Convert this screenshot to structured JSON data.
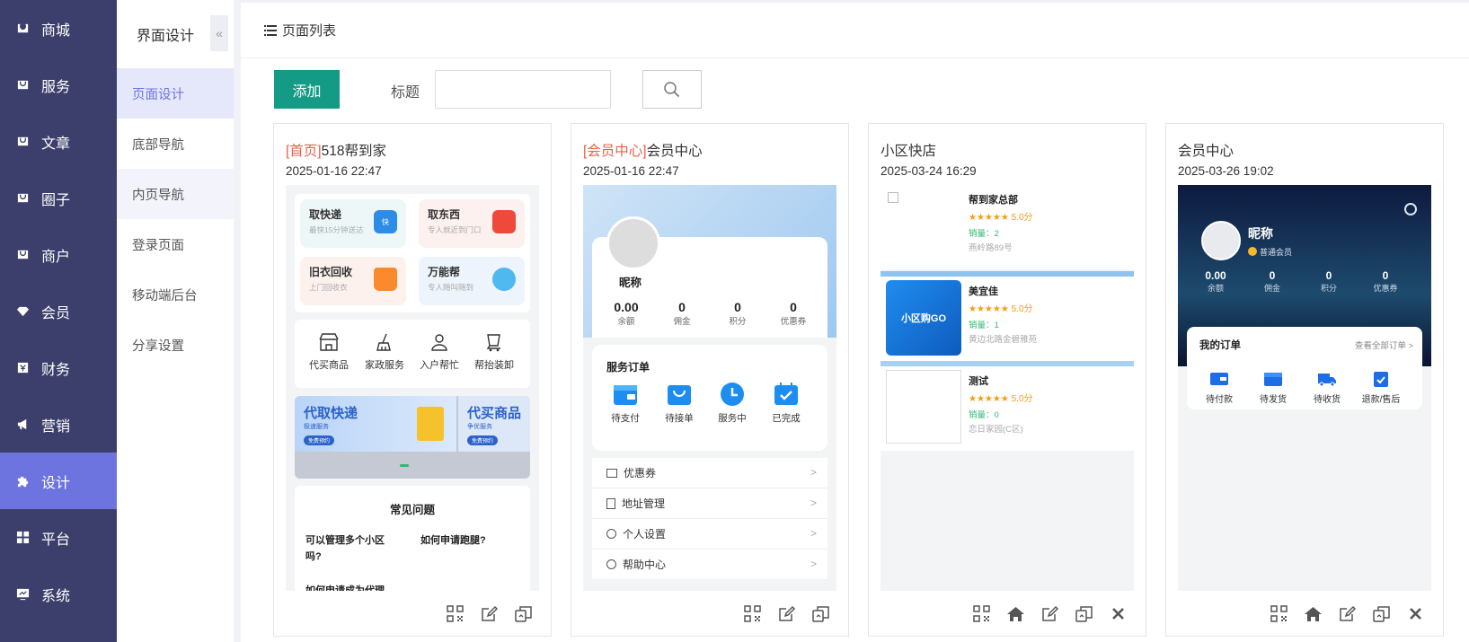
{
  "sidebar": {
    "items": [
      {
        "label": "商城",
        "icon": "store-icon"
      },
      {
        "label": "服务",
        "icon": "service-icon"
      },
      {
        "label": "文章",
        "icon": "article-icon"
      },
      {
        "label": "圈子",
        "icon": "circle-icon"
      },
      {
        "label": "商户",
        "icon": "merchant-icon"
      },
      {
        "label": "会员",
        "icon": "diamond-icon"
      },
      {
        "label": "财务",
        "icon": "finance-icon"
      },
      {
        "label": "营销",
        "icon": "megaphone-icon"
      },
      {
        "label": "设计",
        "icon": "puzzle-icon"
      },
      {
        "label": "平台",
        "icon": "grid-icon"
      },
      {
        "label": "系统",
        "icon": "monitor-icon"
      }
    ],
    "active_index": 8
  },
  "subnav": {
    "title": "界面设计",
    "collapse_glyph": "«",
    "items": [
      "页面设计",
      "底部导航",
      "内页导航",
      "登录页面",
      "移动端后台",
      "分享设置"
    ],
    "active_index": 0
  },
  "header": {
    "title": "页面列表"
  },
  "toolbar": {
    "add_label": "添加",
    "title_label": "标题",
    "title_placeholder": ""
  },
  "colors": {
    "sidebar_bg": "#3c3f6b",
    "active_accent": "#6d74e0",
    "primary_button": "#149b86",
    "tag_red": "#e5634d"
  },
  "cards": [
    {
      "tag": "[首页]",
      "title": "518帮到家",
      "date": "2025-01-16 22:47",
      "actions": [
        "qrcode-icon",
        "edit-icon",
        "copy-icon"
      ],
      "preview": {
        "services": [
          {
            "title": "取快递",
            "sub": "最快15分钟送达",
            "badge": "快"
          },
          {
            "title": "取东西",
            "sub": "专人就近到门口"
          },
          {
            "title": "旧衣回收",
            "sub": "上门回收衣"
          },
          {
            "title": "万能帮",
            "sub": "专人随叫随到"
          }
        ],
        "quick": [
          "代买商品",
          "家政服务",
          "入户帮忙",
          "帮抬装卸"
        ],
        "banner": {
          "left_title": "代取快递",
          "left_sub": "极速服务",
          "left_btn": "免费预约",
          "right_title": "代买商品",
          "right_sub": "争优服务",
          "right_btn": "免费预约"
        },
        "faq": {
          "title": "常见问题",
          "q1": "可以管理多个小区吗?",
          "q2": "如何申请跑腿?",
          "q3": "如何申请成为代理"
        }
      }
    },
    {
      "tag": "[会员中心]",
      "title": "会员中心",
      "date": "2025-01-16 22:47",
      "actions": [
        "qrcode-icon",
        "edit-icon",
        "copy-icon"
      ],
      "preview": {
        "nickname": "昵称",
        "stats": [
          {
            "v": "0.00",
            "k": "余额"
          },
          {
            "v": "0",
            "k": "佣金"
          },
          {
            "v": "0",
            "k": "积分"
          },
          {
            "v": "0",
            "k": "优惠券"
          }
        ],
        "orders_title": "服务订单",
        "orders": [
          "待支付",
          "待接单",
          "服务中",
          "已完成"
        ],
        "rows": [
          "优惠券",
          "地址管理",
          "个人设置",
          "帮助中心"
        ]
      }
    },
    {
      "tag": "",
      "title": "小区快店",
      "date": "2025-03-24 16:29",
      "actions": [
        "qrcode-icon",
        "home-icon",
        "edit-icon",
        "copy-icon",
        "delete-icon"
      ],
      "preview": {
        "shops": [
          {
            "name": "帮到家总部",
            "stars": "★★★★★",
            "score": "5.0分",
            "sales": "销量：2",
            "addr": "燕岭路89号"
          },
          {
            "name": "美宜佳",
            "stars": "★★★★★",
            "score": "5.0分",
            "sales": "销量：1",
            "addr": "黄边北路金碧雅苑",
            "logo": "小区购GO"
          },
          {
            "name": "测试",
            "stars": "★★★★★",
            "score": "5.0分",
            "sales": "销量：0",
            "addr": "恋日家园(C区)"
          }
        ]
      }
    },
    {
      "tag": "",
      "title": "会员中心",
      "date": "2025-03-26 19:02",
      "actions": [
        "qrcode-icon",
        "home-icon",
        "edit-icon",
        "copy-icon",
        "delete-icon"
      ],
      "preview": {
        "nickname": "昵称",
        "level": "普通会员",
        "stats": [
          {
            "v": "0.00",
            "k": "余额"
          },
          {
            "v": "0",
            "k": "佣金"
          },
          {
            "v": "0",
            "k": "积分"
          },
          {
            "v": "0",
            "k": "优惠券"
          }
        ],
        "orders_title": "我的订单",
        "orders_more": "查看全部订单 >",
        "orders": [
          "待付款",
          "待发货",
          "待收货",
          "退款/售后"
        ]
      }
    }
  ]
}
